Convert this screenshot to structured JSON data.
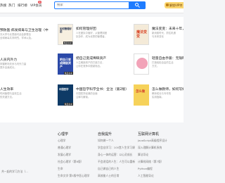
{
  "nav": {
    "items": [
      "热搜",
      "热门",
      "排行榜",
      "VIP会员"
    ],
    "vip_badge": "新"
  },
  "search": {
    "placeholder": "搜索"
  },
  "vip_card": {
    "label": "解锁VIP特"
  },
  "books": [
    {
      "title": "预防医·病发病毒与卫生治理（中",
      "desc": [
        "次大学与北表面可此会卸载合",
        "全球病毒共享研究、学术以及。"
      ],
      "cover_text": "",
      "cover_color": "#ffffff",
      "tag": ""
    },
    {
      "title": "如何管理好团",
      "desc": [
        "人在团队中管好，从管理到团",
        "队协作，成为优秀的管理者。"
      ],
      "cover_text": "如何管理好团",
      "cover_color": "#f7efe0",
      "tag": "精选书单"
    },
    {
      "title": "魔法变变：未来十年，",
      "desc": [
        "新消费时代，抓住机遇",
        "与未来变化"
      ],
      "cover_text": "魔法变变",
      "cover_color": "#f4ead8",
      "tag": ""
    },
    {
      "title": "人员内外力",
      "desc": [
        "掌握职场关系与内外力量",
        "提升自我成长。"
      ],
      "cover_text": "",
      "cover_color": "#ffffff",
      "tag": ""
    },
    {
      "title": "把自己变成稀缺资产",
      "desc": [
        "人生稀缺资产的打造方法，",
        "让你在竞争中脱颖而出。"
      ],
      "cover_text": "把自己变成稀缺资产",
      "cover_color": "#2b49a8",
      "tag": "精选书单"
    },
    {
      "title": "轻量自由手册：无限时光",
      "desc": [
        "打造轻松自由的生活",
        "方式。"
      ],
      "cover_text": "",
      "cover_color": "#ffffff",
      "tag": ""
    },
    {
      "title": "人生效率",
      "desc": [
        "时间管理与高效生活",
        "的关键方法。"
      ],
      "cover_text": "",
      "cover_color": "#ffffff",
      "tag": ""
    },
    {
      "title": "中国哲学科学全书：全注（第2版）",
      "desc": [
        "中国哲学经典的全面",
        "注释与解读。"
      ],
      "cover_text": "中国哲学",
      "cover_color": "#0e3a66",
      "tag": "精选书单"
    },
    {
      "title": "怎么做教师，如何写好",
      "desc": [
        "教师成长与写作的",
        "实用指南。"
      ],
      "cover_text": "怎么做",
      "cover_color": "#f6d25a",
      "tag": ""
    }
  ],
  "footer": {
    "columns": [
      {
        "head": "",
        "items": [
          "",
          "",
          "",
          "共一起的学习方法（...",
          ""
        ]
      },
      {
        "head": "心理学",
        "items": [
          "心理学",
          "普通心理学",
          "发展心理学",
          "社会心理学（第6版）",
          "生命",
          "生命文学·第5版中医心理学"
        ]
      },
      {
        "head": "自我提升",
        "items": [
          "如何做一个人",
          "学会自学习：100堂人生学习课",
          "身心一体的运营：以心灵成长",
          "不会说话的人生：人生可以重新",
          "自己做自己的人生",
          "高效能人士的日常"
        ]
      },
      {
        "head": "互联网计算机",
        "items": [
          "JavaScript高级程序设计",
          "深入理解计算机系统",
          "算法导论",
          "计算机网络（第7版）",
          "Python编程",
          "人工智能导论"
        ]
      }
    ]
  }
}
